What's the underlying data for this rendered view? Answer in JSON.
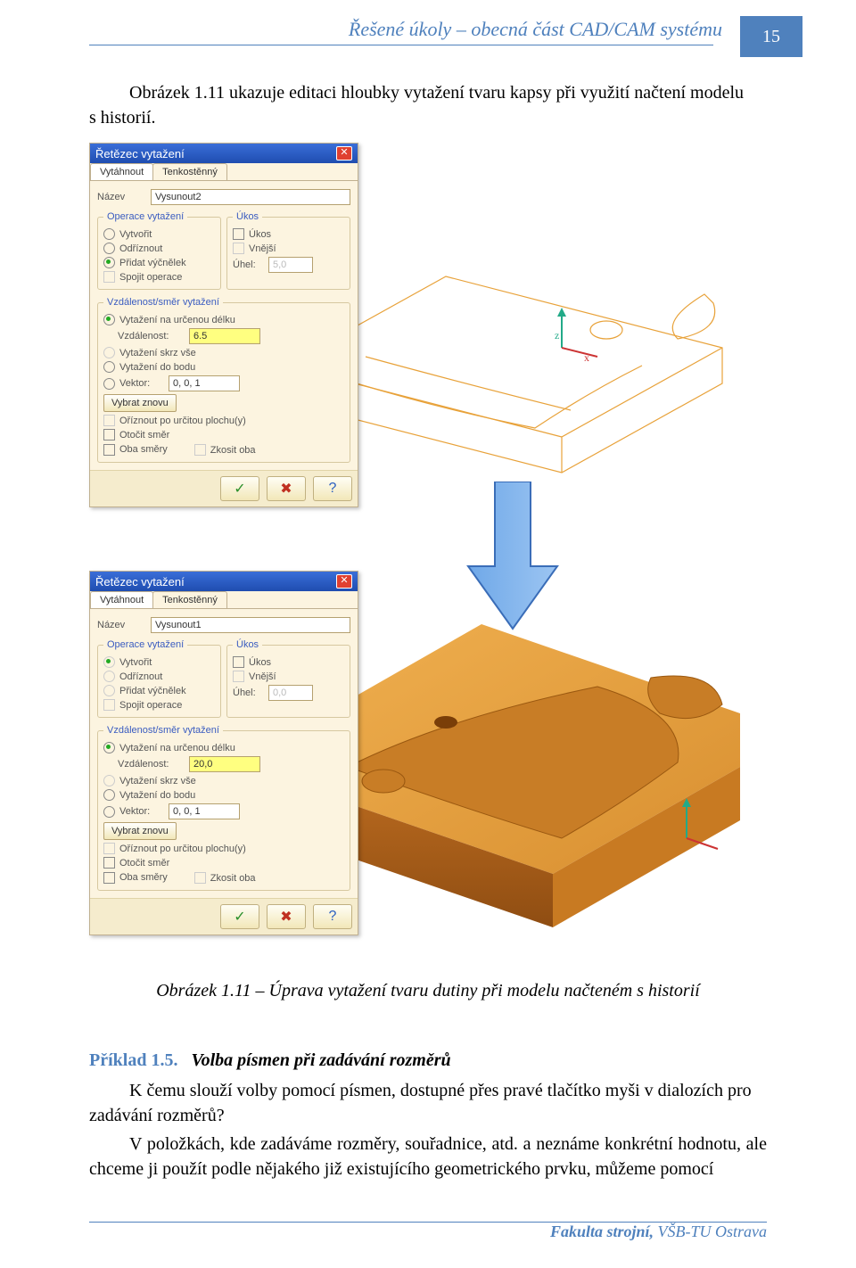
{
  "header": {
    "title": "Řešené úkoly – obecná část CAD/CAM systému",
    "page": "15"
  },
  "intro": {
    "l1": "Obrázek 1.11 ukazuje editaci hloubky vytažení tvaru kapsy při využití načtení modelu",
    "l2": "s historií."
  },
  "dialog": {
    "title": "Řetězec vytažení",
    "tabs": {
      "t1": "Vytáhnout",
      "t2": "Tenkostěnný"
    },
    "name_lbl": "Název",
    "name_val1": "Vysunout2",
    "name_val2": "Vysunout1",
    "op_legend": "Operace vytažení",
    "op_create": "Vytvořit",
    "op_cut": "Odříznout",
    "op_add": "Přidat výčnělek",
    "op_join": "Spojit operace",
    "ukos_legend": "Úkos",
    "ukos_chk": "Úkos",
    "ukos_outer": "Vnější",
    "ukos_angle_lbl": "Úhel:",
    "ukos_angle_val": "5,0",
    "ukos_angle_val2": "0,0",
    "dist_legend": "Vzdálenost/směr vytažení",
    "dist_len": "Vytažení na určenou délku",
    "dist_lbl": "Vzdálenost:",
    "dist_val1": "6.5",
    "dist_val2": "20,0",
    "dist_thru": "Vytažení skrz vše",
    "dist_pt": "Vytažení do bodu",
    "vec_lbl": "Vektor:",
    "vec_val": "0, 0, 1",
    "resel": "Vybrat znovu",
    "trim": "Oříznout po určitou plochu(y)",
    "flip": "Otočit směr",
    "both": "Oba směry",
    "mirror": "Zkosit oba",
    "ok": "✓",
    "cancel": "✖",
    "help": "?"
  },
  "caption": "Obrázek 1.11 – Úprava vytažení tvaru dutiny při modelu načteném s historií",
  "example": {
    "num": "Příklad 1.5.",
    "title": "Volba písmen při zadávání rozměrů",
    "p1": "K čemu slouží volby pomocí písmen, dostupné přes pravé tlačítko myši v dialozích pro zadávání rozměrů?",
    "p2": "V položkách, kde zadáváme rozměry, souřadnice, atd. a neznáme konkrétní hodnotu, ale chceme ji použít podle nějakého již existujícího geometrického prvku, můžeme pomocí"
  },
  "footer": {
    "fac": "Fakulta strojní, ",
    "uni": "VŠB-TU Ostrava"
  }
}
